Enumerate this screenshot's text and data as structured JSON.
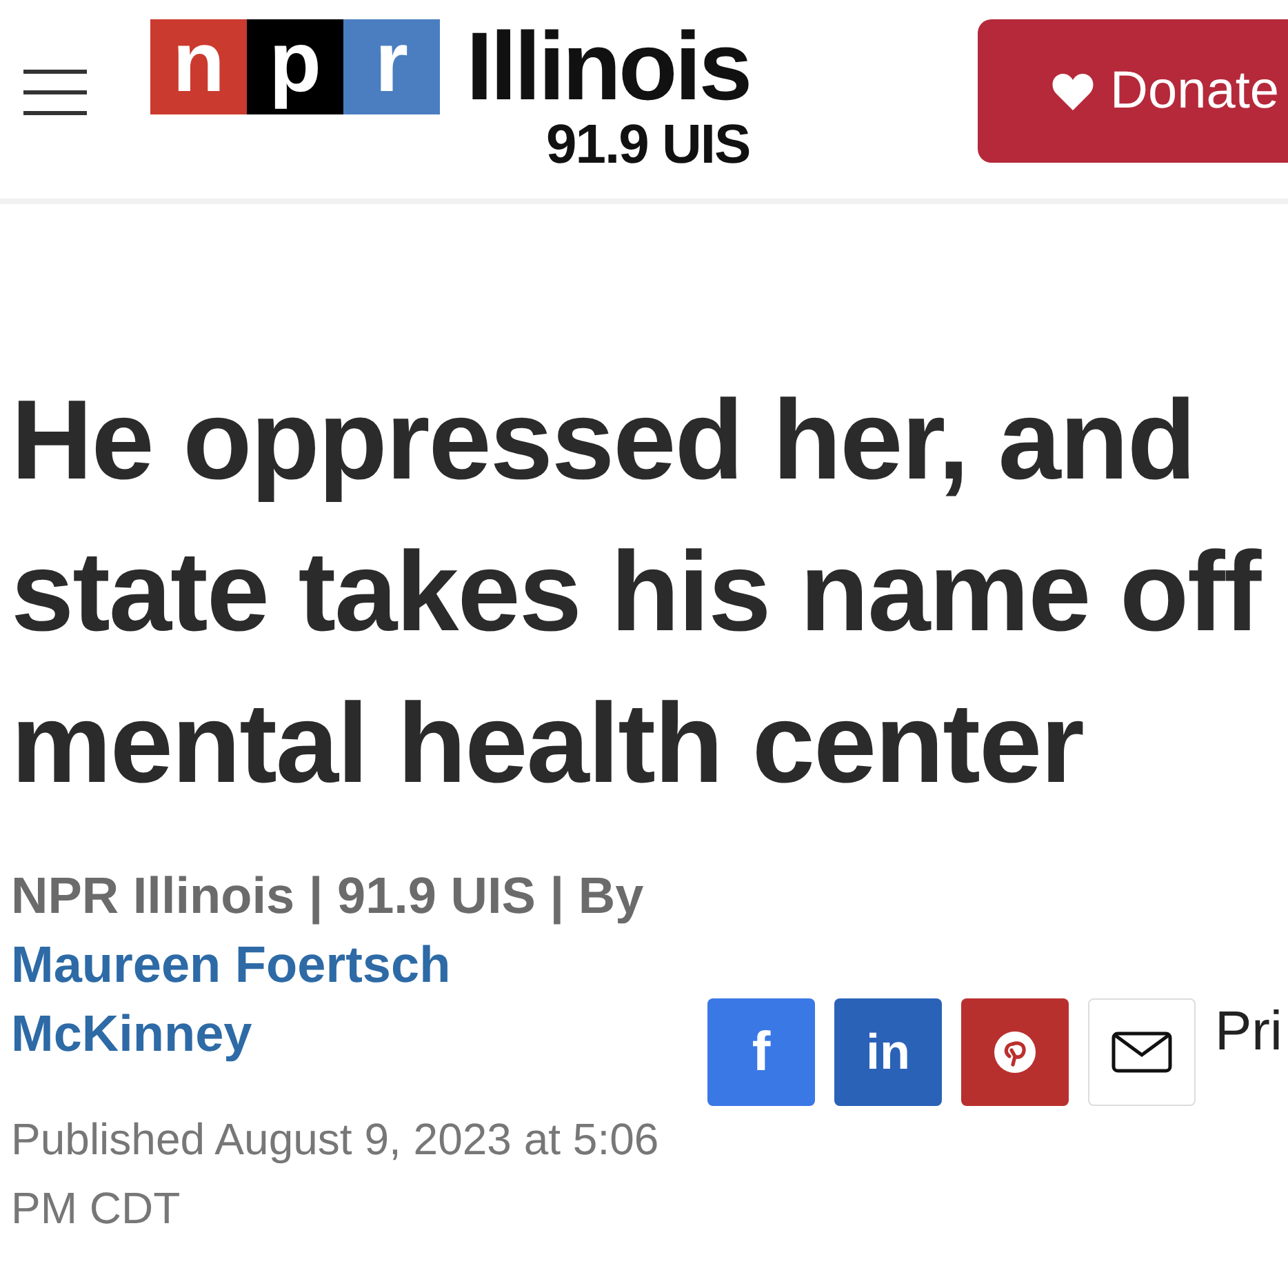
{
  "header": {
    "logo": {
      "letters": [
        {
          "text": "n",
          "color": "#cb3a2e"
        },
        {
          "text": "p",
          "color": "#000000"
        },
        {
          "text": "r",
          "color": "#4a7ec0"
        }
      ],
      "name": "Illinois",
      "station": "91.9 UIS"
    },
    "donate_button": {
      "label": "Donate"
    }
  },
  "article": {
    "headline": "He oppressed her, and state takes his name off mental health center",
    "byline": {
      "prefix": "NPR Illinois | 91.9 UIS | By",
      "author": "Maureen Foertsch McKinney"
    },
    "published": "Published August 9, 2023 at 5:06 PM CDT",
    "share_buttons": [
      {
        "kind": "facebook",
        "label": "f"
      },
      {
        "kind": "linkedin",
        "label": "in"
      },
      {
        "kind": "pinterest"
      },
      {
        "kind": "email"
      }
    ],
    "print_label": "Pri"
  }
}
